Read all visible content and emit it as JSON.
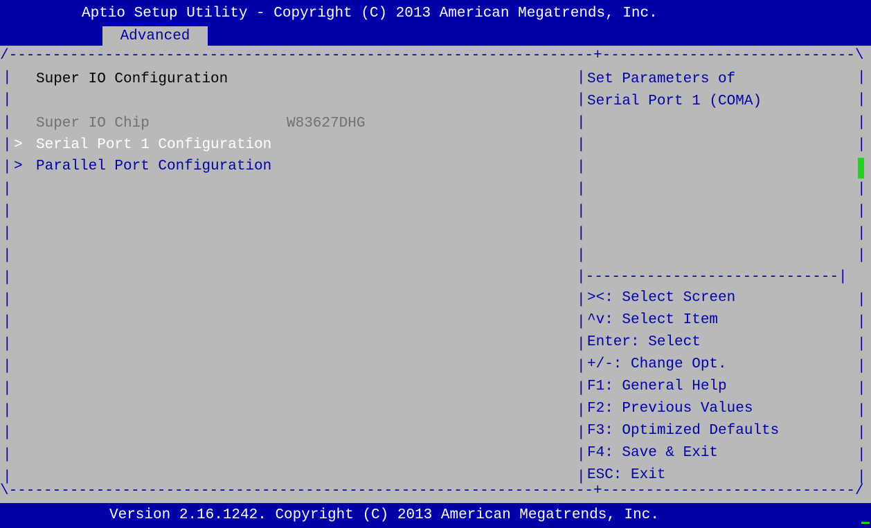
{
  "header": {
    "title": "Aptio Setup Utility - Copyright (C) 2013 American Megatrends, Inc.",
    "active_tab": "Advanced"
  },
  "main": {
    "heading": "Super IO Configuration",
    "chip_label": "Super IO Chip",
    "chip_value": "W83627DHG",
    "items": [
      {
        "marker": ">",
        "label": "Serial Port 1 Configuration",
        "state": "selected"
      },
      {
        "marker": ">",
        "label": "Parallel Port Configuration",
        "state": "normal"
      }
    ]
  },
  "help": {
    "description": [
      "Set Parameters of",
      "Serial Port 1 (COMA)"
    ],
    "keys": [
      "><: Select Screen",
      "^v: Select Item",
      "Enter: Select",
      "+/-: Change Opt.",
      "F1: General Help",
      "F2: Previous Values",
      "F3: Optimized Defaults",
      "F4: Save & Exit",
      "ESC: Exit"
    ]
  },
  "footer": {
    "version": "Version 2.16.1242. Copyright (C) 2013 American Megatrends, Inc."
  },
  "colors": {
    "background": "#b9b9b9",
    "bar_blue": "#0000a8",
    "selected_text": "#ffffff",
    "scroll_thumb": "#22d322"
  }
}
